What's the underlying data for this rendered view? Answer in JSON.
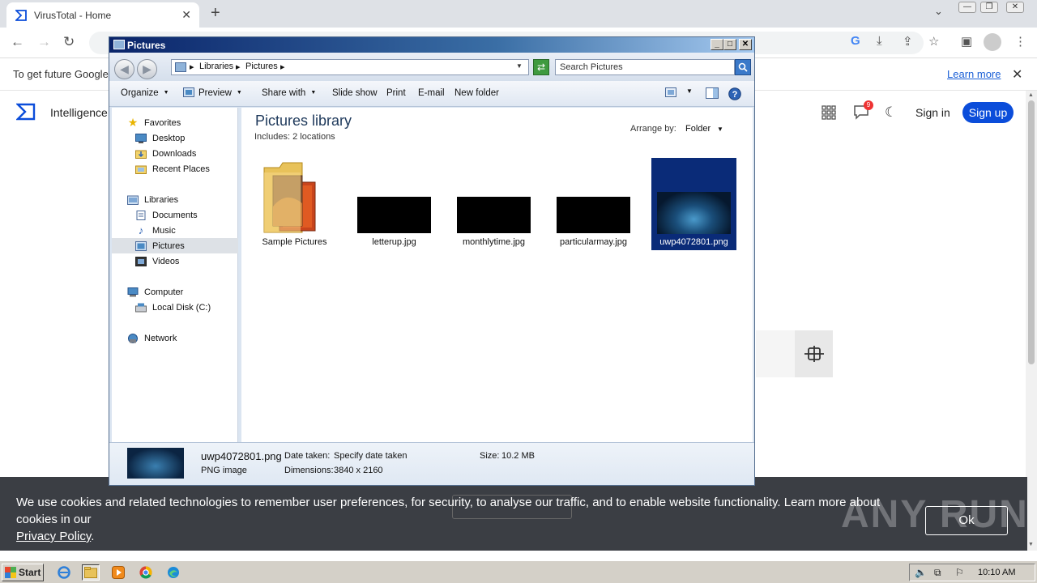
{
  "browser": {
    "tab_title": "VirusTotal - Home",
    "infobar_message": "To get future Google",
    "infobar_link": "Learn more"
  },
  "virustotal": {
    "intelligence_label": "Intelligence",
    "notification_count": "9",
    "signin_label": "Sign in",
    "signup_label": "Sign up",
    "accent_color": "#0b4dda"
  },
  "cookie_banner": {
    "text": "We use cookies and related technologies to remember user preferences, for security, to analyse our traffic, and to enable website functionality. Learn more about cookies in our",
    "policy_link": "Privacy Policy",
    "policy_suffix": ".",
    "ok_label": "Ok"
  },
  "watermark": "ANY RUN",
  "explorer": {
    "title": "Pictures",
    "breadcrumb": [
      "Libraries",
      "Pictures"
    ],
    "search_placeholder": "Search Pictures",
    "commands": {
      "organize": "Organize",
      "preview": "Preview",
      "share_with": "Share with",
      "slide_show": "Slide show",
      "print": "Print",
      "email": "E-mail",
      "new_folder": "New folder"
    },
    "nav": {
      "favorites": "Favorites",
      "desktop": "Desktop",
      "downloads": "Downloads",
      "recent_places": "Recent Places",
      "libraries": "Libraries",
      "documents": "Documents",
      "music": "Music",
      "pictures": "Pictures",
      "videos": "Videos",
      "computer": "Computer",
      "local_disk": "Local Disk (C:)",
      "network": "Network"
    },
    "library_title": "Pictures library",
    "includes_label": "Includes:",
    "includes_value": "2 locations",
    "arrange_by_label": "Arrange by:",
    "arrange_by_value": "Folder",
    "items": [
      {
        "name": "Sample Pictures",
        "type": "folder"
      },
      {
        "name": "letterup.jpg",
        "type": "image"
      },
      {
        "name": "monthlytime.jpg",
        "type": "image"
      },
      {
        "name": "particularmay.jpg",
        "type": "image"
      },
      {
        "name": "uwp4072801.png",
        "type": "image",
        "selected": true
      }
    ],
    "details": {
      "filename": "uwp4072801.png",
      "filetype": "PNG image",
      "date_taken_label": "Date taken:",
      "date_taken_value": "Specify date taken",
      "dimensions_label": "Dimensions:",
      "dimensions_value": "3840 x 2160",
      "size_label": "Size:",
      "size_value": "10.2 MB"
    }
  },
  "taskbar": {
    "start_label": "Start",
    "clock": "10:10 AM"
  }
}
